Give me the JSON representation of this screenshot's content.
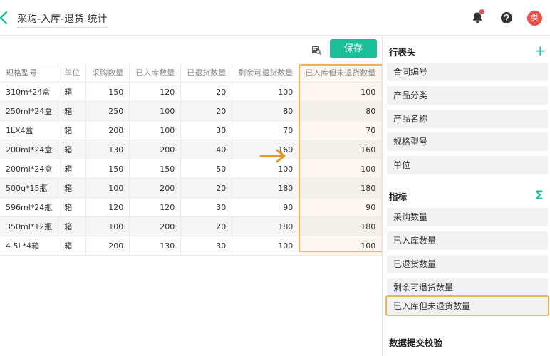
{
  "header": {
    "title": "采购-入库-退货 统计",
    "avatar_text": "娄",
    "icons": [
      "back-chevron-icon",
      "bell-icon",
      "help-icon"
    ],
    "notification_dot_color": "#f04b4b"
  },
  "toolbar": {
    "save_label": "保存",
    "icons": [
      "preview-icon"
    ]
  },
  "table": {
    "columns": [
      "规格型号",
      "单位",
      "采购数量",
      "已入库数量",
      "已退货数量",
      "剩余可退货数量",
      "已入库但未退货数量"
    ],
    "rows": [
      [
        "310m*24盒",
        "箱",
        "150",
        "120",
        "20",
        "100",
        "100"
      ],
      [
        "250ml*24盒",
        "箱",
        "250",
        "100",
        "20",
        "80",
        "80"
      ],
      [
        "1LX4盒",
        "箱",
        "200",
        "100",
        "30",
        "70",
        "70"
      ],
      [
        "200ml*24盒",
        "箱",
        "130",
        "200",
        "40",
        "160",
        "160"
      ],
      [
        "200ml*24盒",
        "箱",
        "150",
        "150",
        "50",
        "100",
        "100"
      ],
      [
        "500g*15瓶",
        "箱",
        "100",
        "200",
        "20",
        "180",
        "180"
      ],
      [
        "596ml*24瓶",
        "箱",
        "120",
        "120",
        "30",
        "90",
        "90"
      ],
      [
        "350ml*12瓶",
        "箱",
        "100",
        "200",
        "20",
        "180",
        "180"
      ],
      [
        "4.5L*4箱",
        "箱",
        "200",
        "130",
        "30",
        "100",
        "100"
      ]
    ],
    "highlight_color": "#f2b34a"
  },
  "panel": {
    "row_header": {
      "title": "行表头",
      "items": [
        "合同编号",
        "产品分类",
        "产品名称",
        "规格型号",
        "单位"
      ]
    },
    "metrics": {
      "title": "指标",
      "items": [
        "采购数量",
        "已入库数量",
        "已退货数量",
        "剩余可退货数量",
        "已入库但未退货数量"
      ]
    },
    "validation": {
      "title": "数据提交校验"
    }
  },
  "colors": {
    "accent": "#1abf9a",
    "highlight": "#f2b34a",
    "arrow": "#e8961f"
  }
}
